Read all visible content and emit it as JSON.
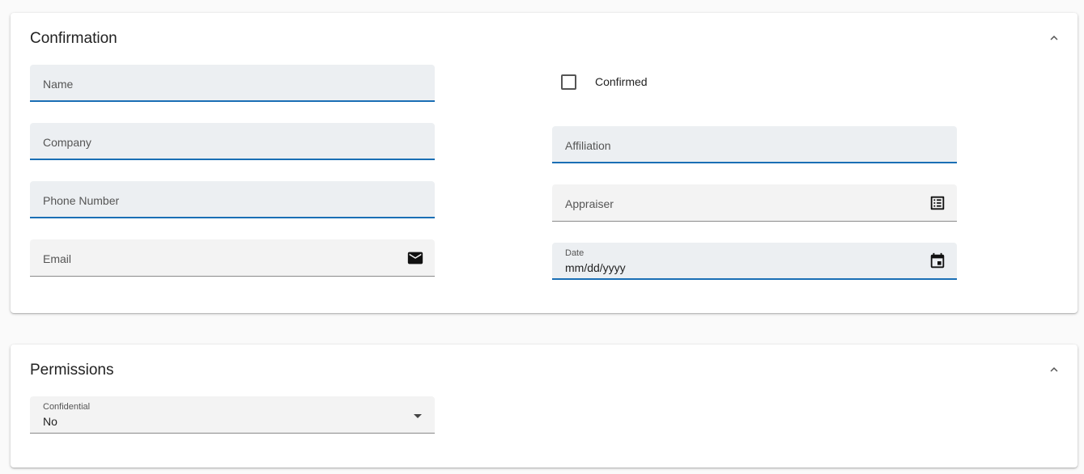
{
  "confirmation": {
    "title": "Confirmation",
    "fields": {
      "name": {
        "label": "Name"
      },
      "company": {
        "label": "Company"
      },
      "phone": {
        "label": "Phone Number"
      },
      "email": {
        "label": "Email",
        "icon": "mail-icon"
      },
      "confirmed": {
        "label": "Confirmed",
        "checked": false
      },
      "affiliation": {
        "label": "Affiliation"
      },
      "appraiser": {
        "label": "Appraiser",
        "icon": "list-picker-icon"
      },
      "date": {
        "label": "Date",
        "value": "mm/dd/yyyy",
        "icon": "calendar-icon"
      }
    }
  },
  "permissions": {
    "title": "Permissions",
    "confidential": {
      "label": "Confidential",
      "value": "No"
    }
  },
  "colors": {
    "accent": "#1a6fb5",
    "field_bg": "#f3f3f3",
    "field_bg_active": "#eceff2"
  }
}
